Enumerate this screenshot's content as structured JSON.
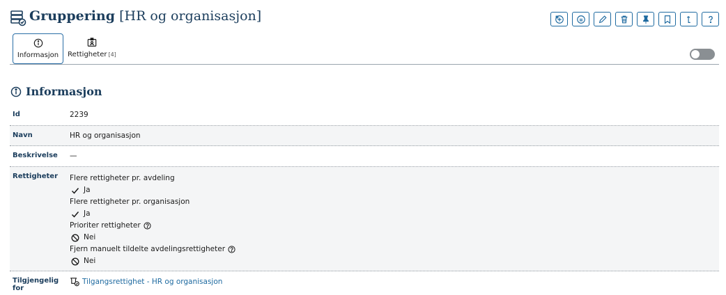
{
  "header": {
    "title_strong": "Gruppering",
    "title_rest": "[HR og organisasjon]",
    "icon": "grouping-icon"
  },
  "toolbar": {
    "buttons": [
      {
        "name": "add-circle-icon"
      },
      {
        "name": "copy-circle-icon"
      },
      {
        "name": "edit-icon"
      },
      {
        "name": "delete-icon"
      },
      {
        "name": "pin-icon"
      },
      {
        "name": "bookmark-icon"
      },
      {
        "name": "export-icon"
      },
      {
        "name": "help-icon"
      }
    ]
  },
  "tabs": {
    "info_label": "Informasjon",
    "rights_label": "Rettigheter",
    "rights_count": "[4]"
  },
  "toggle": {
    "on": false
  },
  "section": {
    "title": "Informasjon"
  },
  "fields": {
    "id_label": "Id",
    "id_value": "2239",
    "navn_label": "Navn",
    "navn_value": "HR og organisasjon",
    "beskrivelse_label": "Beskrivelse",
    "beskrivelse_value": "—",
    "rettigheter_label": "Rettigheter",
    "tilgjengelig_label": "Tilgjengelig for",
    "tilgjengelig_value": "Tilgangsrettighet - HR og organisasjon"
  },
  "rettigheter": [
    {
      "label": "Flere rettigheter pr. avdeling",
      "status": "Ja",
      "help": false
    },
    {
      "label": "Flere rettigheter pr. organisasjon",
      "status": "Ja",
      "help": false
    },
    {
      "label": "Prioriter rettigheter",
      "status": "Nei",
      "help": true
    },
    {
      "label": "Fjern manuelt tildelte avdelingsrettigheter",
      "status": "Nei",
      "help": true
    }
  ],
  "colors": {
    "accent": "#1e6aa0",
    "heading": "#1b3d5c"
  }
}
